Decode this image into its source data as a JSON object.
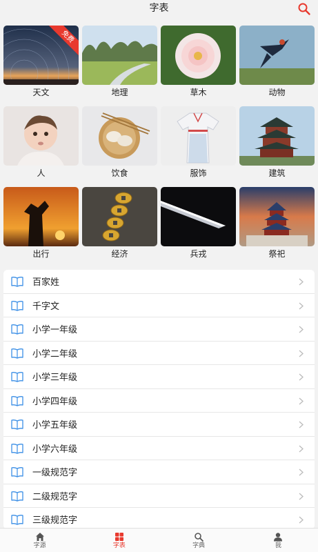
{
  "header": {
    "title": "字表"
  },
  "grid": [
    {
      "label": "天文",
      "badge": "免费"
    },
    {
      "label": "地理"
    },
    {
      "label": "草木"
    },
    {
      "label": "动物"
    },
    {
      "label": "人"
    },
    {
      "label": "饮食"
    },
    {
      "label": "服饰"
    },
    {
      "label": "建筑"
    },
    {
      "label": "出行"
    },
    {
      "label": "经济"
    },
    {
      "label": "兵戎"
    },
    {
      "label": "祭祀"
    }
  ],
  "list": [
    "百家姓",
    "千字文",
    "小学一年级",
    "小学二年级",
    "小学三年级",
    "小学四年级",
    "小学五年级",
    "小学六年级",
    "一级规范字",
    "二级规范字",
    "三级规范字"
  ],
  "tabbar": [
    {
      "label": "字源",
      "icon": "home-icon"
    },
    {
      "label": "字表",
      "icon": "grid-icon",
      "active": true
    },
    {
      "label": "字典",
      "icon": "search-icon"
    },
    {
      "label": "我",
      "icon": "user-icon"
    }
  ],
  "colors": {
    "accent": "#e8392e",
    "icon_blue": "#3a8ee6",
    "background": "#f2f2f2"
  }
}
